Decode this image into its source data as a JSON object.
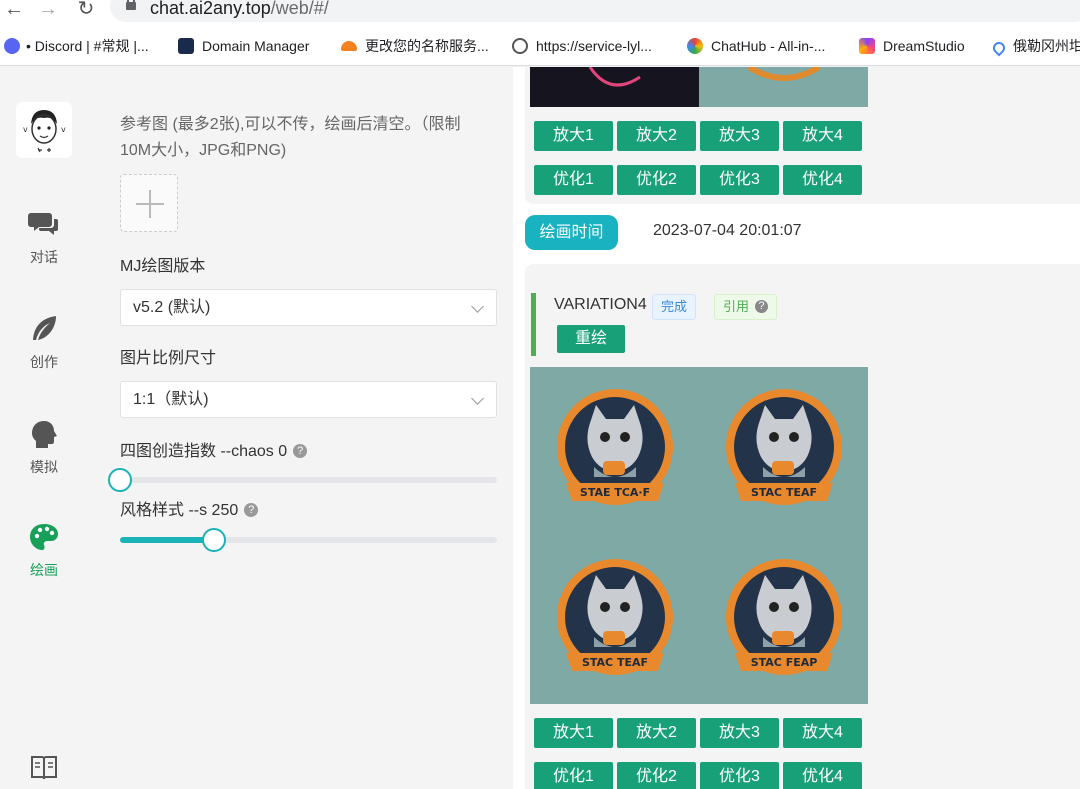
{
  "browser": {
    "url_host": "chat.ai2any.top",
    "url_path": "/web/#/",
    "bookmarks": [
      {
        "label": "• Discord | #常规 |...",
        "color": "#5865f2"
      },
      {
        "label": "Domain Manager",
        "color": "#1a2a4a"
      },
      {
        "label": "更改您的名称服务...",
        "color": "#f48120"
      },
      {
        "label": "https://service-lyl...",
        "color": "#555"
      },
      {
        "label": "ChatHub - All-in-...",
        "color": "#e94235"
      },
      {
        "label": "DreamStudio",
        "color": "#8a3ffc"
      },
      {
        "label": "俄勒冈州坩",
        "color": "#4285f4"
      }
    ]
  },
  "rail": {
    "items": [
      {
        "label": "对话",
        "icon": "chat-bubbles-icon"
      },
      {
        "label": "创作",
        "icon": "feather-icon"
      },
      {
        "label": "模拟",
        "icon": "head-profile-icon"
      },
      {
        "label": "绘画",
        "icon": "palette-icon"
      },
      {
        "label": "教程",
        "icon": "book-icon"
      }
    ]
  },
  "panel": {
    "ref_hint_line1": "参考图 (最多2张),可以不传，绘画后清空。（限制",
    "ref_hint_line2": "10M大小，JPG和PNG)",
    "version_label": "MJ绘图版本",
    "version_value": "v5.2 (默认)",
    "ratio_label": "图片比例尺寸",
    "ratio_value": "1:1（默认)",
    "chaos_label": "四图创造指数 --chaos 0",
    "chaos_value": 0,
    "style_label": "风格样式 --s 250",
    "style_value": 250,
    "style_max": 1000,
    "help": "?"
  },
  "content": {
    "upscale_labels": [
      "放大1",
      "放大2",
      "放大3",
      "放大4"
    ],
    "vary_labels": [
      "优化1",
      "优化2",
      "优化3",
      "优化4"
    ],
    "time_pill": "绘画时间",
    "time_value": "2023-07-04 20:01:07",
    "variation_title": "VARIATION4",
    "status_tag": "完成",
    "ref_tag": "引用",
    "redraw": "重绘",
    "badge_texts": [
      "STAE TCA·F",
      "STAC TEAF",
      "STAC TEAF",
      "STAC FEAP"
    ]
  },
  "colors": {
    "accent": "#18a078",
    "teal": "#18b2c0",
    "active_rail": "#18a058"
  }
}
